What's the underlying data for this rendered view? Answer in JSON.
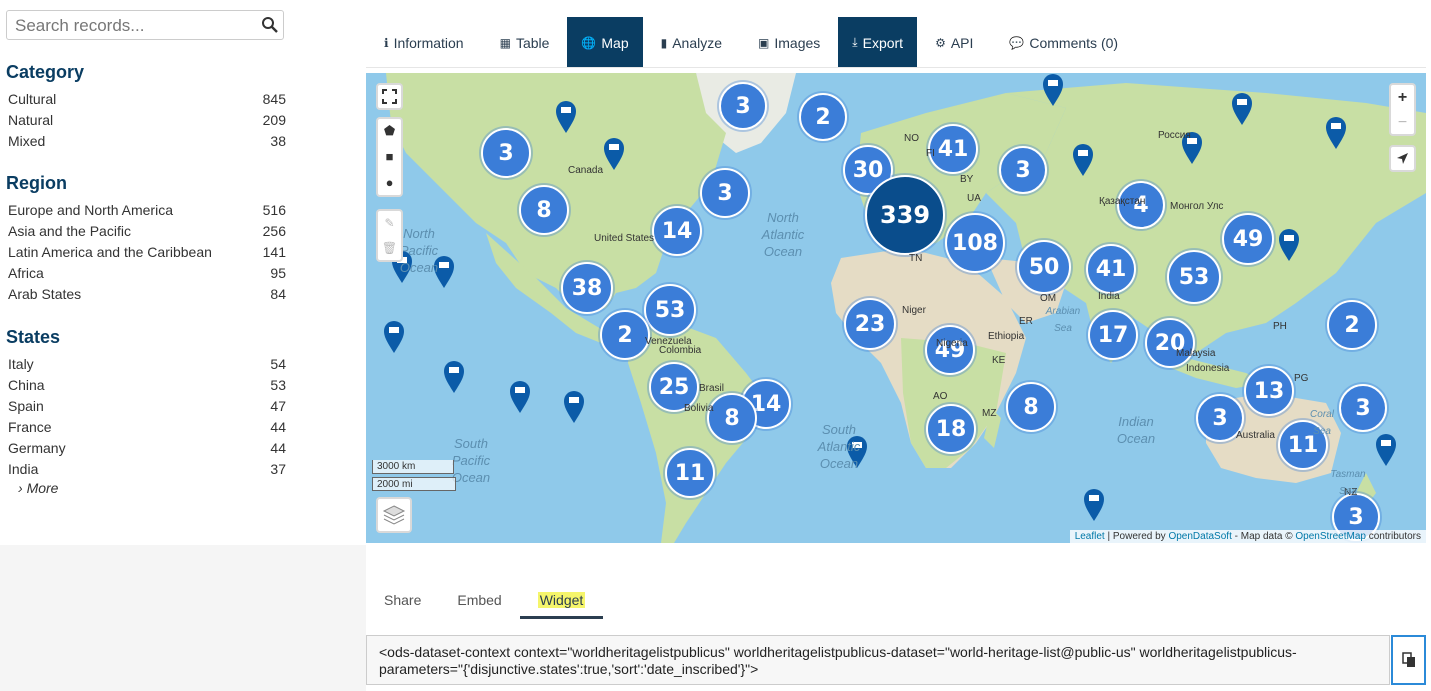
{
  "search": {
    "placeholder": "Search records..."
  },
  "facets": {
    "category": {
      "title": "Category",
      "items": [
        {
          "label": "Cultural",
          "count": "845"
        },
        {
          "label": "Natural",
          "count": "209"
        },
        {
          "label": "Mixed",
          "count": "38"
        }
      ]
    },
    "region": {
      "title": "Region",
      "items": [
        {
          "label": "Europe and North America",
          "count": "516"
        },
        {
          "label": "Asia and the Pacific",
          "count": "256"
        },
        {
          "label": "Latin America and the Caribbean",
          "count": "141"
        },
        {
          "label": "Africa",
          "count": "95"
        },
        {
          "label": "Arab States",
          "count": "84"
        }
      ]
    },
    "states": {
      "title": "States",
      "items": [
        {
          "label": "Italy",
          "count": "54"
        },
        {
          "label": "China",
          "count": "53"
        },
        {
          "label": "Spain",
          "count": "47"
        },
        {
          "label": "France",
          "count": "44"
        },
        {
          "label": "Germany",
          "count": "44"
        },
        {
          "label": "India",
          "count": "37"
        }
      ],
      "more": "More"
    }
  },
  "tabs": [
    {
      "label": "Information",
      "icon": "info-icon",
      "glyph": "ℹ",
      "active": false
    },
    {
      "label": "Table",
      "icon": "table-icon",
      "glyph": "▦",
      "active": false
    },
    {
      "label": "Map",
      "icon": "globe-icon",
      "glyph": "🌐",
      "active": true
    },
    {
      "label": "Analyze",
      "icon": "bar-chart-icon",
      "glyph": "▮",
      "active": false
    },
    {
      "label": "Images",
      "icon": "image-icon",
      "glyph": "▣",
      "active": false
    },
    {
      "label": "Export",
      "icon": "download-icon",
      "glyph": "⤓",
      "active": true
    },
    {
      "label": "API",
      "icon": "cogs-icon",
      "glyph": "⚙",
      "active": false
    },
    {
      "label": "Comments (0)",
      "icon": "comments-icon",
      "glyph": "💬",
      "active": false
    }
  ],
  "map": {
    "clusters": [
      "3",
      "2",
      "3",
      "41",
      "30",
      "3",
      "8",
      "3",
      "339",
      "14",
      "4",
      "108",
      "49",
      "38",
      "50",
      "41",
      "53",
      "53",
      "2",
      "23",
      "17",
      "20",
      "2",
      "25",
      "49",
      "14",
      "13",
      "8",
      "8",
      "3",
      "3",
      "18",
      "11",
      "11",
      "3"
    ],
    "places": [
      "Canada",
      "United States",
      "NO",
      "FI",
      "BY",
      "UA",
      "TN",
      "Niger",
      "Nigeria",
      "Venezuela",
      "Colombia",
      "Brasil",
      "Bolivia",
      "AO",
      "MZ",
      "Ethiopia",
      "KE",
      "India",
      "Indonesia",
      "Australia",
      "PG",
      "PH",
      "Россия",
      "Қазақстан",
      "Монгол Улс",
      "ER",
      "OM",
      "Malaysia",
      "NZ"
    ],
    "oceans": [
      {
        "text": "North Pacific Ocean"
      },
      {
        "text": "North Atlantic Ocean"
      },
      {
        "text": "South Pacific Ocean"
      },
      {
        "text": "South Atlantic Ocean"
      },
      {
        "text": "Indian Ocean"
      },
      {
        "text": "Arabian Sea"
      },
      {
        "text": "Coral Sea"
      },
      {
        "text": "Tasman Sea"
      }
    ],
    "scale_km": "3000 km",
    "scale_mi": "2000 mi",
    "zoom_in": "+",
    "zoom_out": "−",
    "attribution": {
      "leaflet": "Leaflet",
      "powered": "| Powered by",
      "ods": "OpenDataSoft",
      "mapdata": "- Map data ©",
      "osm": "OpenStreetMap",
      "contrib": "contributors"
    }
  },
  "share": {
    "tabs": [
      "Share",
      "Embed",
      "Widget"
    ],
    "active": "Widget",
    "code": "<ods-dataset-context context=\"worldheritagelistpublicus\" worldheritagelistpublicus-dataset=\"world-heritage-list@public-us\" worldheritagelistpublicus-parameters=\"{'disjunctive.states':true,'sort':'date_inscribed'}\">"
  },
  "colors": {
    "accent": "#0a3d62",
    "cluster": "#3b7dd8",
    "ocean": "#8fc9ea",
    "land": "#c8dfa4"
  }
}
